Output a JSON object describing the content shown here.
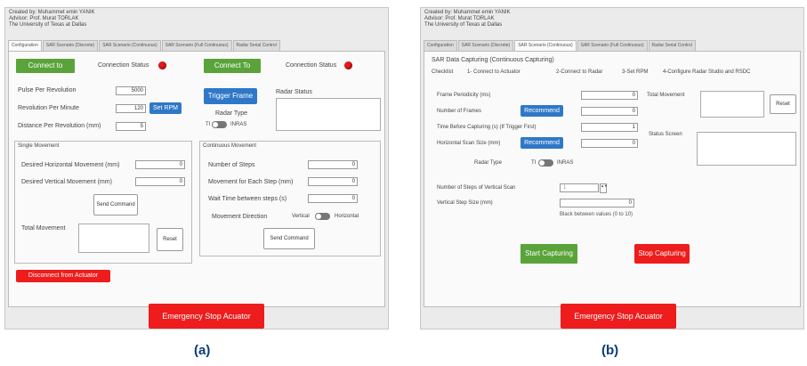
{
  "credits": [
    "Created by: Muhammet emin YANIK",
    "Advisor: Prof. Murat TORLAK",
    "The University of Texas at Dallas"
  ],
  "tabs": [
    "Configuration",
    "SAR Scenario (Discrete)",
    "SAR Scenario (Continuous)",
    "SAR Scenario (Full Continuous)",
    "Radar Serial Control"
  ],
  "a": {
    "connect_actuator": "Connect to Actuator",
    "connection_status": "Connection Status",
    "connect_radar": "Connect To Radar",
    "pulse_rev_label": "Pulse Per Revolution",
    "pulse_rev_value": "5000",
    "rev_min_label": "Revolution Per Minute",
    "rev_min_value": "120",
    "set_rpm": "Set RPM",
    "dist_rev_label": "Distance Per Revolution (mm)",
    "dist_rev_value": "5",
    "trigger_frame": "Trigger Frame",
    "radar_status": "Radar Status",
    "radar_type": "Radar Type",
    "radar_type_left": "TI",
    "radar_type_right": "INRAS",
    "single_movement": "Single Movement",
    "desired_h_label": "Desired Horizontal Movement (mm)",
    "desired_h_value": "0",
    "desired_v_label": "Desired Vertical Movement (mm)",
    "desired_v_value": "0",
    "send_command": "Send Command",
    "total_movement": "Total Movement",
    "reset": "Reset",
    "continuous_movement": "Continuous Movement",
    "num_steps": "Number of Steps",
    "num_steps_value": "0",
    "move_each_step": "Movement for Each Step (mm)",
    "move_each_step_value": "0",
    "wait_time": "Wait Time between steps (s)",
    "wait_time_value": "0",
    "movement_direction": "Movement Direction",
    "vertical": "Vertical",
    "horizontal": "Horizontal",
    "send_command2": "Send Command",
    "disconnect": "Disconnect from Actuator",
    "emergency": "Emergency Stop Acuator"
  },
  "b": {
    "section_title": "SAR Data Capturing (Continuous Capturing)",
    "checklist": "Checklist",
    "check1": "1- Connect to Actuator",
    "check2": "2-Connect to Radar",
    "check3": "3-Set RPM",
    "check4": "4-Configure Radar Studio and RSDC",
    "frame_period_label": "Frame Periodicity (ms)",
    "frame_period_value": "0",
    "num_frames_label": "Number of Frames",
    "num_frames_value": "0",
    "recommend": "Recommend",
    "time_before_label": "Time Before Capturing (s) (If Trigger First)",
    "time_before_value": "1",
    "horiz_scan_label": "Horizontal Scan Size (mm)",
    "horiz_scan_value": "0",
    "total_movement": "Total Movement",
    "reset": "Reset",
    "status_screen": "Status Screen",
    "radar_type": "Radar Type",
    "radar_type_left": "TI",
    "radar_type_right": "INRAS",
    "num_vert_label": "Number of Steps of Vertical Scan",
    "num_vert_value": "1",
    "vert_step_label": "Vertical Step Size (mm)",
    "vert_step_value": "0",
    "hint": "Black between values (0 to 10)",
    "start": "Start Capturing",
    "stop": "Stop Capturing",
    "emergency": "Emergency Stop Acuator"
  },
  "captions": [
    "(a)",
    "(b)"
  ],
  "colors": {
    "green": "#5aa33a",
    "red": "#ee1c1c",
    "blue": "#2f78c8",
    "caption": "#0a3a7a"
  }
}
